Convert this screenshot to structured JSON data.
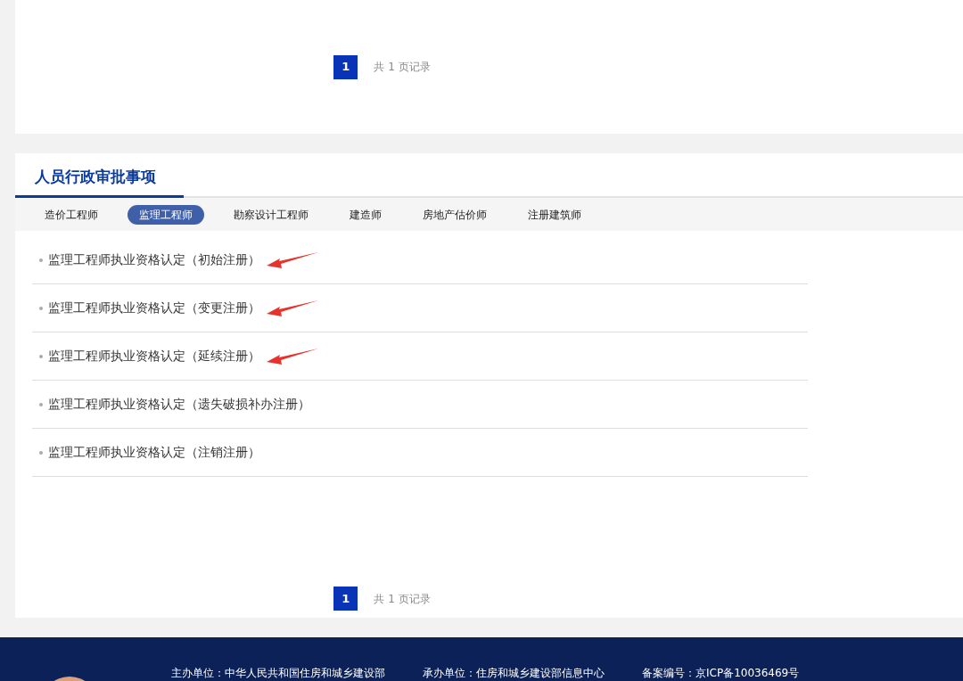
{
  "top_pagination": {
    "pages": [
      {
        "label": "1",
        "selected": true
      }
    ],
    "summary": "共 1 页记录"
  },
  "section": {
    "title": "人员行政审批事项",
    "tabs": [
      {
        "label": "造价工程师",
        "selected": false
      },
      {
        "label": "监理工程师",
        "selected": true
      },
      {
        "label": "勘察设计工程师",
        "selected": false
      },
      {
        "label": "建造师",
        "selected": false
      },
      {
        "label": "房地产估价师",
        "selected": false
      },
      {
        "label": "注册建筑师",
        "selected": false
      }
    ],
    "items": [
      {
        "label": "监理工程师执业资格认定（初始注册）",
        "marked": true
      },
      {
        "label": "监理工程师执业资格认定（变更注册）",
        "marked": true
      },
      {
        "label": "监理工程师执业资格认定（延续注册）",
        "marked": true
      },
      {
        "label": "监理工程师执业资格认定（遗失破损补办注册）",
        "marked": false
      },
      {
        "label": "监理工程师执业资格认定（注销注册）",
        "marked": false
      }
    ],
    "pagination": {
      "pages": [
        {
          "label": "1",
          "selected": true
        }
      ],
      "summary": "共 1 页记录"
    }
  },
  "footer": {
    "items": [
      "主办单位：中华人民共和国住房和城乡建设部",
      "承办单位：住房和城乡建设部信息中心",
      "备案编号：京ICP备10036469号"
    ]
  }
}
